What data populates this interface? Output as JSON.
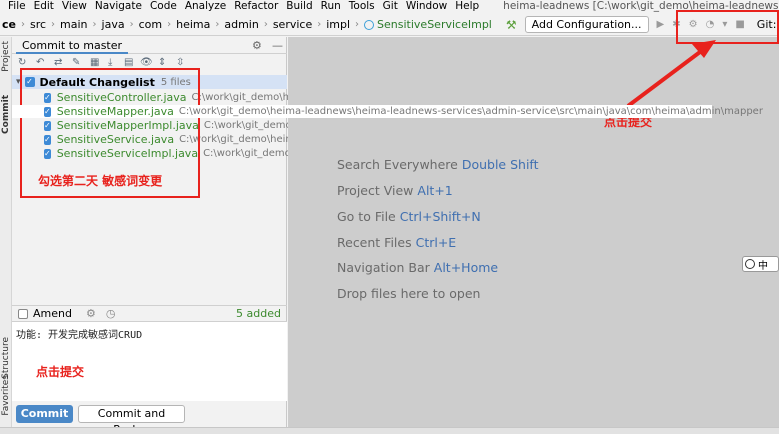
{
  "menu": {
    "items": [
      "File",
      "Edit",
      "View",
      "Navigate",
      "Code",
      "Analyze",
      "Refactor",
      "Build",
      "Run",
      "Tools",
      "Git",
      "Window",
      "Help"
    ],
    "window_title": "heima-leadnews [C:\\work\\git_demo\\heima-leadnews]"
  },
  "navbar": {
    "crumbs": [
      "ce",
      "src",
      "main",
      "java",
      "com",
      "heima",
      "admin",
      "service",
      "impl"
    ],
    "current_file": "SensitiveServiceImpl",
    "add_config": "Add Configuration...",
    "git_label": "Git:"
  },
  "side_tabs": {
    "project": "Project",
    "commit": "Commit",
    "structure": "Structure",
    "favorites": "Favorites"
  },
  "commit_panel": {
    "tab_label": "Commit to master",
    "changelist": {
      "name": "Default Changelist",
      "count": "5 files"
    },
    "files": [
      {
        "name": "SensitiveController.java",
        "path": "C:\\work\\git_demo\\hei"
      },
      {
        "name": "SensitiveMapper.java",
        "path": "C:\\work\\git_demo\\heima-leadnews\\heima-leadnews-services\\admin-service\\src\\main\\java\\com\\heima\\admin\\mapper"
      },
      {
        "name": "SensitiveMapperImpl.java",
        "path": "C:\\work\\git_demo\\he"
      },
      {
        "name": "SensitiveService.java",
        "path": "C:\\work\\git_demo\\heima"
      },
      {
        "name": "SensitiveServiceImpl.java",
        "path": "C:\\work\\git_demo\\he"
      }
    ],
    "amend_label": "Amend",
    "added_count": "5 added",
    "message": "功能: 开发完成敏感词CRUD",
    "commit_button": "Commit",
    "commit_push_button": "Commit and Push..."
  },
  "editor_hints": [
    {
      "text": "Search Everywhere",
      "key": "Double Shift"
    },
    {
      "text": "Project View",
      "key": "Alt+1"
    },
    {
      "text": "Go to File",
      "key": "Ctrl+Shift+N"
    },
    {
      "text": "Recent Files",
      "key": "Ctrl+E"
    },
    {
      "text": "Navigation Bar",
      "key": "Alt+Home"
    },
    {
      "text": "Drop files here to open",
      "key": ""
    }
  ],
  "annotations": {
    "check_files": "勾选第二天 敏感词变更",
    "click_commit_top": "点击提交",
    "click_commit_bottom": "点击提交"
  },
  "ime_indicator": "中",
  "colors": {
    "accent": "#4a88c7",
    "annotation_red": "#e8221d",
    "file_green": "#3c8a2e"
  }
}
